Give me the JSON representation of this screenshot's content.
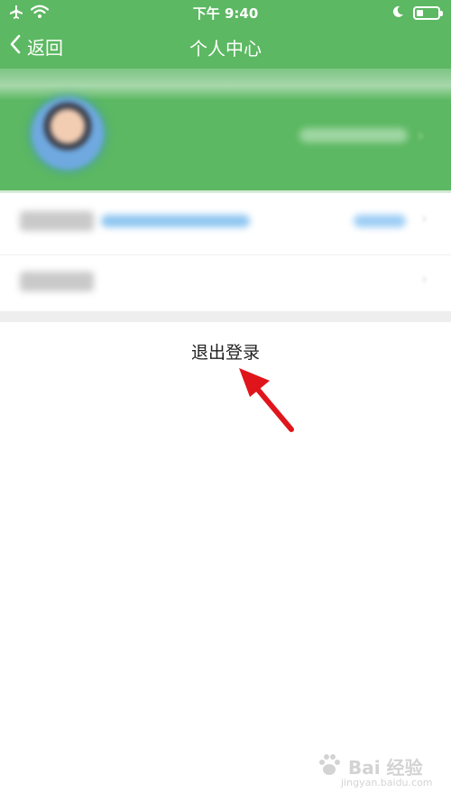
{
  "status_bar": {
    "time": "下午 9:40",
    "battery_level": 0.3,
    "icons": [
      "airplane-icon",
      "wifi-icon",
      "moon-icon",
      "battery-icon"
    ]
  },
  "nav": {
    "back_label": "返回",
    "title": "个人中心"
  },
  "actions": {
    "logout_label": "退出登录"
  },
  "colors": {
    "header_green": "#5cb862",
    "arrow_red": "#e0151b",
    "link_blue": "#3a9ef0"
  },
  "watermark": {
    "brand": "Bai 经验",
    "domain": "jingyan.baidu.com"
  }
}
